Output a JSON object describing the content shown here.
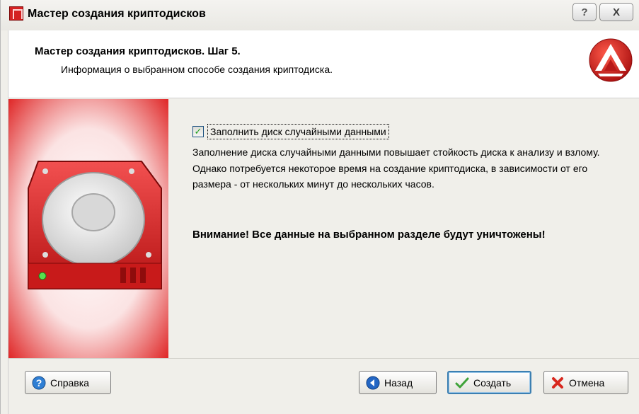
{
  "window": {
    "title": "Мастер создания криптодисков",
    "help_button": "?",
    "close_button": "X"
  },
  "header": {
    "title": "Мастер создания криптодисков. Шаг 5.",
    "subtitle": "Информация о выбранном способе создания криптодиска."
  },
  "content": {
    "checkbox_label": "Заполнить диск случайными данными",
    "checkbox_checked": true,
    "description": "Заполнение диска случайными данными повышает стойкость диска к анализу и взлому. Однако потребуется некоторое время на создание криптодиска, в зависимости от его размера - от нескольких минут до нескольких часов.",
    "warning": "Внимание! Все данные на выбранном разделе будут уничтожены!"
  },
  "footer": {
    "help_label": "Справка",
    "back_label": "Назад",
    "create_label": "Создать",
    "cancel_label": "Отмена"
  },
  "icons": {
    "app": "app-icon",
    "logo": "logo-icon",
    "disk": "hard-disk-icon",
    "help": "help-icon",
    "back": "back-arrow-icon",
    "create": "checkmark-icon",
    "cancel": "cancel-icon"
  },
  "colors": {
    "accent_red": "#cc1f1f",
    "window_bg": "#f0efea",
    "header_bg": "#ffffff"
  }
}
